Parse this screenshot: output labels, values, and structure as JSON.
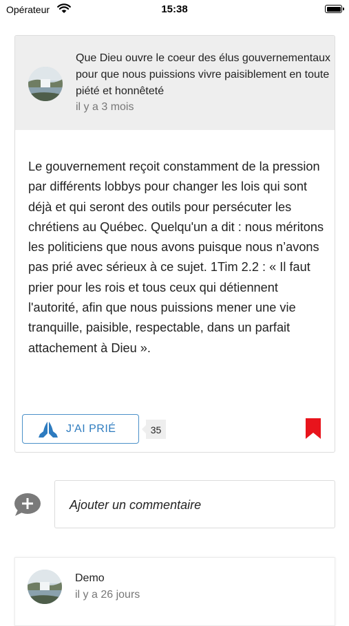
{
  "status_bar": {
    "carrier": "Opérateur",
    "time": "15:38"
  },
  "post": {
    "title": "Que Dieu ouvre le coeur des élus gouvernementaux pour que nous puissions vivre paisiblement en toute piété et honnêteté",
    "time_ago": "il y a 3 mois",
    "body": "Le gouvernement reçoit constamment de la pression par différents lobbys pour changer les lois qui sont déjà et qui seront des outils pour persécuter les chrétiens au Québec. Quelqu'un a dit : nous méritons les politiciens que nous avons puisque nous n’avons pas prié avec sérieux à ce sujet. 1Tim 2.2 : « Il faut prier pour les rois et tous ceux qui détiennent l'autorité, afin que nous puissions mener une vie tranquille, paisible, respectable, dans un parfait attachement à Dieu ».",
    "pray_button_label": "J'AI PRIÉ",
    "pray_count": "35",
    "bookmark_icon": "bookmark-icon",
    "colors": {
      "accent": "#2d7bbf",
      "bookmark": "#e8141c"
    }
  },
  "comment_box": {
    "placeholder": "Ajouter un commentaire",
    "icon": "add-comment-icon"
  },
  "comments": [
    {
      "author": "Demo",
      "time_ago": "il y a 26 jours"
    }
  ]
}
